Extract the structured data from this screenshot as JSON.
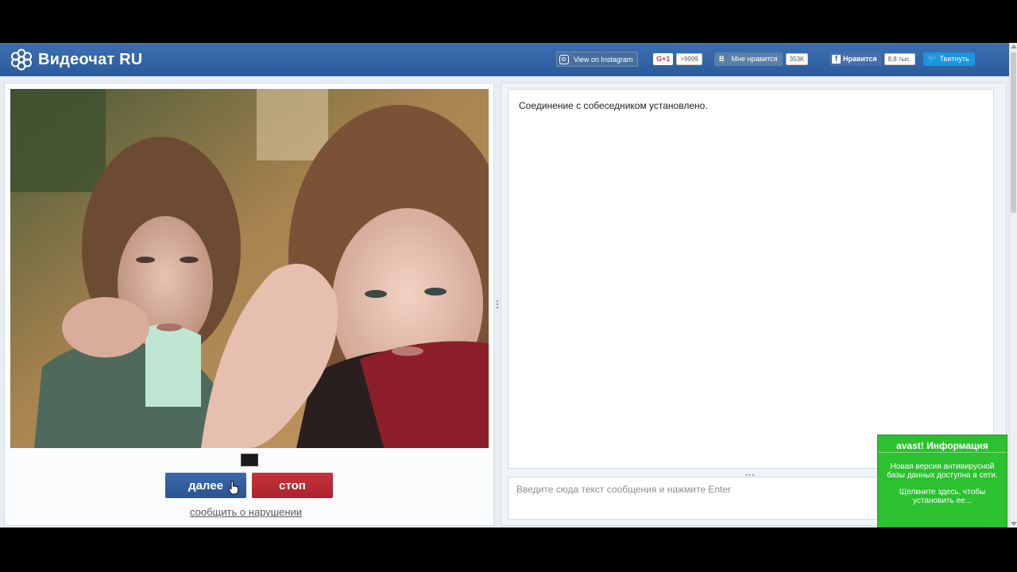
{
  "header": {
    "logo_text": "Видеочат RU",
    "instagram_label": "View on Instagram",
    "gplus_label": "G+1",
    "gplus_count": ">9999",
    "vk_letter": "B",
    "vk_label": "Мне нравится",
    "vk_count": "353K",
    "fb_label": "Нравится",
    "fb_count": "8,8 тыс.",
    "twitter_label": "Твитнуть"
  },
  "video": {
    "next_label": "далее",
    "stop_label": "стоп",
    "report_label": "сообщить о нарушении"
  },
  "chat": {
    "system_message": "Соединение с собеседником установлено.",
    "input_placeholder": "Введите сюда текст сообщения и нажмите Enter",
    "input_value": ""
  },
  "avast": {
    "title": "avast! Информация",
    "line1": "Новая версия антивирусной базы данных доступна в сети.",
    "line2": "Щелкните здесь, чтобы установить ее..."
  },
  "colors": {
    "header_blue": "#2b5b9c",
    "next_blue": "#2a538f",
    "stop_red": "#a9242b",
    "avast_green": "#2cc12f"
  }
}
